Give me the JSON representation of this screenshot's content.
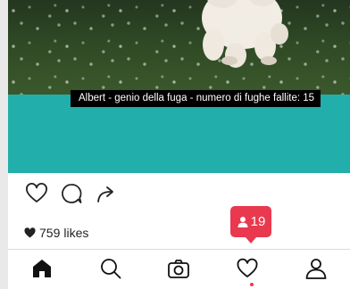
{
  "post": {
    "caption": "Albert - genio della fuga - numero di fughe fallite: 15",
    "likes_count": "759",
    "likes_label": "likes"
  },
  "notification_badge": {
    "count": "19",
    "color": "#e8394f"
  },
  "colors": {
    "accent": "#22aeaa",
    "badge": "#e8394f"
  },
  "tabbar": {
    "items": [
      "home-icon",
      "search-icon",
      "camera-icon",
      "heart-icon",
      "profile-icon"
    ],
    "active": "home-icon"
  },
  "actions": [
    "heart-icon",
    "comment-icon",
    "share-icon"
  ]
}
